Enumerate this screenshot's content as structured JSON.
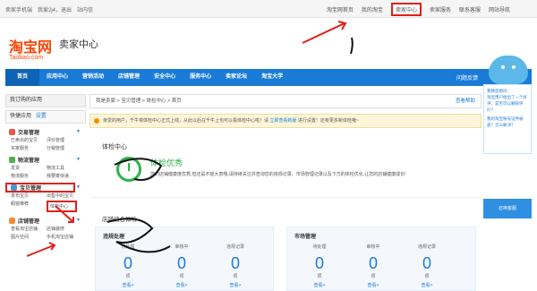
{
  "topbar": {
    "seller_mobile": "卖家手机端",
    "greeting": "我爱2j4，退出",
    "messages": "站内信",
    "links": [
      "淘宝网首页",
      "我的淘宝",
      "卖家中心",
      "卖家服务",
      "联系客服",
      "网站导航"
    ],
    "seller_center_active": "卖家中心"
  },
  "brand": {
    "logo_big": "淘宝网",
    "logo_small": "Taobao.com",
    "title": "卖家中心"
  },
  "nav": {
    "items": [
      "首页",
      "应用中心",
      "营销活动",
      "店铺管理",
      "安全中心",
      "服务中心",
      "卖家论坛",
      "淘宝大学"
    ],
    "help": "问题反馈"
  },
  "sidebar": {
    "my_apps": "我订购的应用",
    "quick_apps": "快捷应用",
    "quick_set": "设置",
    "groups": [
      {
        "title": "交易管理",
        "color": "#e9564c",
        "links": [
          "已卖出的宝贝",
          "评价管理",
          "买家服务",
          "分销管理"
        ]
      },
      {
        "title": "物流管理",
        "color": "#52b04e",
        "links": [
          "发货",
          "物流工具",
          "物流服务",
          "我要寄快递"
        ]
      },
      {
        "title": "宝贝管理",
        "color": "#3e9ad9",
        "links": [
          "发布宝贝",
          "出售中的宝贝",
          "橱窗推荐",
          "体检中心"
        ]
      },
      {
        "title": "店铺管理",
        "color": "#f08c3b",
        "links": [
          "查看淘宝店铺",
          "店铺装修",
          "图片空间",
          "手机淘宝店铺"
        ]
      }
    ]
  },
  "breadcrumb": {
    "path": "我是卖家 > 宝贝管理 > 体检中心 > 首页",
    "right": "查看帮助"
  },
  "notice": {
    "text": "亲爱的用户，千牛将体检中心正式上线，从此以后在千牛上也可以看体检中心啦！请",
    "link": "立即查看新版",
    "tail": "进行设置！还有更多新体检哦~"
  },
  "check": {
    "title": "体检中心",
    "status": "体检优秀",
    "desc": "您的店铺健康度优秀,但还是不能大意哦,请持续关注并查询您的违规记录、市场管理记录以及下方的体检优化,让您的店铺健康成长!"
  },
  "score": {
    "title": "店铺综合体检",
    "panels": [
      {
        "heading": "违规处理",
        "cols": [
          {
            "label": "待处理",
            "value": "0",
            "unit": "项",
            "more": "查看>"
          },
          {
            "label": "审核中",
            "value": "0",
            "unit": "项",
            "more": "查看>"
          },
          {
            "label": "违规记录",
            "value": "0",
            "unit": "项",
            "more": "查看>"
          }
        ]
      },
      {
        "heading": "市场管理",
        "cols": [
          {
            "label": "待处理",
            "value": "0",
            "unit": "项",
            "more": "查看>"
          },
          {
            "label": "审核中",
            "value": "0",
            "unit": "项",
            "more": "查看>"
          },
          {
            "label": "违规记录",
            "value": "0",
            "unit": "项",
            "more": "查看>"
          }
        ]
      }
    ]
  },
  "robot": {
    "hi": "我猜您想问：",
    "q1": "淘宝用户给出了一个好评，是否可以删除评价？",
    "q2": "我的淘宝账号证件被盗？怎么解决？",
    "btn": "召唤客服"
  }
}
